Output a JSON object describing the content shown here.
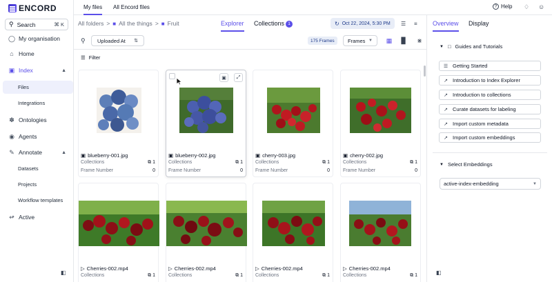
{
  "brand": {
    "name": "ENCORD"
  },
  "search": {
    "label": "Search",
    "shortcut": "⌘ K"
  },
  "sidebar": {
    "items": [
      {
        "label": "My organisation"
      },
      {
        "label": "Home"
      },
      {
        "label": "Index"
      },
      {
        "label": "Ontologies"
      },
      {
        "label": "Agents"
      },
      {
        "label": "Annotate"
      },
      {
        "label": "Active"
      }
    ],
    "index_sub": [
      {
        "label": "Files"
      },
      {
        "label": "Integrations"
      }
    ],
    "annotate_sub": [
      {
        "label": "Datasets"
      },
      {
        "label": "Projects"
      },
      {
        "label": "Workflow templates"
      }
    ]
  },
  "top": {
    "tabs": [
      {
        "label": "My files"
      },
      {
        "label": "All Encord files"
      }
    ],
    "help": "Help"
  },
  "breadcrumb": {
    "root": "All folders",
    "sep": ">",
    "level1": "All the things",
    "level2": "Fruit"
  },
  "view_tabs": [
    {
      "label": "Explorer"
    },
    {
      "label": "Collections",
      "badge": "1"
    }
  ],
  "date": {
    "label": "Oct 22, 2024, 5:30 PM"
  },
  "toolbar": {
    "sort_label": "Uploaded At",
    "frames_count": "175 Frames",
    "frames_select": "Frames",
    "filter_label": "Filter"
  },
  "cards": [
    {
      "name": "blueberry-001.jpg",
      "collections_label": "Collections",
      "collections": "1",
      "frame_label": "Frame Number",
      "frame": "0"
    },
    {
      "name": "blueberry-002.jpg",
      "collections_label": "Collections",
      "collections": "1",
      "frame_label": "Frame Number",
      "frame": "0"
    },
    {
      "name": "cherry-003.jpg",
      "collections_label": "Collections",
      "collections": "1",
      "frame_label": "Frame Number",
      "frame": "0"
    },
    {
      "name": "cherry-002.jpg",
      "collections_label": "Collections",
      "collections": "1",
      "frame_label": "Frame Number",
      "frame": "0"
    },
    {
      "name": "Cherries-002.mp4",
      "collections_label": "Collections",
      "collections": "1"
    },
    {
      "name": "Cherries-002.mp4",
      "collections_label": "Collections",
      "collections": "1"
    },
    {
      "name": "Cherries-002.mp4",
      "collections_label": "Collections",
      "collections": "1"
    },
    {
      "name": "Cherries-002.mp4",
      "collections_label": "Collections",
      "collections": "1"
    }
  ],
  "right_panel": {
    "tabs": [
      {
        "label": "Overview"
      },
      {
        "label": "Display"
      }
    ],
    "guides_title": "Guides and Tutorials",
    "guides": [
      {
        "label": "Getting Started"
      },
      {
        "label": "Introduction to Index Explorer"
      },
      {
        "label": "Introduction to collections"
      },
      {
        "label": "Curate datasets for labeling"
      },
      {
        "label": "Import custom metadata"
      },
      {
        "label": "Import custom embeddings"
      }
    ],
    "embeddings_title": "Select Embeddings",
    "embeddings_value": "active-index-embedding"
  },
  "colors": {
    "accent": "#5b4fe9",
    "active_bg": "#eef0fc",
    "date_bg": "#e8edf7"
  }
}
